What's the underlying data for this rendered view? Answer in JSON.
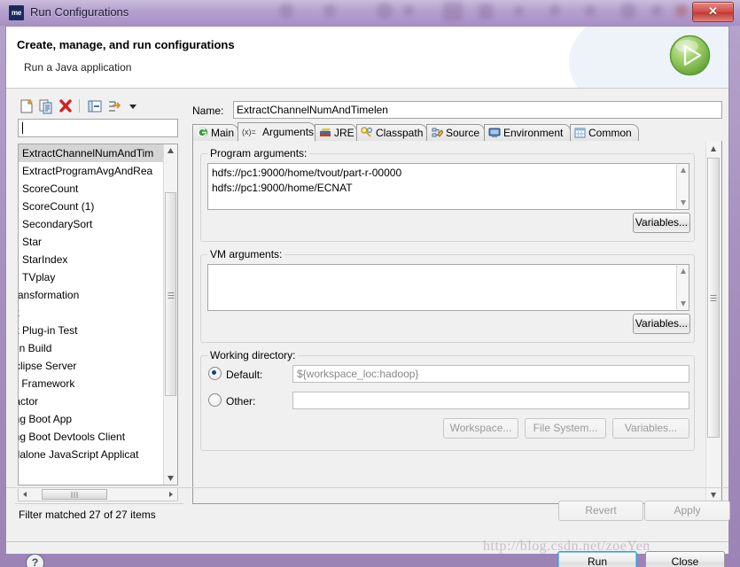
{
  "window": {
    "title": "Run Configurations",
    "app_icon": "me",
    "close_label": "✕"
  },
  "banner": {
    "title": "Create, manage, and run configurations",
    "subtitle": "Run a Java application",
    "icon": "run-green-play-icon"
  },
  "left_panel": {
    "toolbar": [
      {
        "name": "new-launch-configuration-icon",
        "title": "New launch configuration"
      },
      {
        "name": "duplicate-launch-configuration-icon",
        "title": "Duplicate"
      },
      {
        "name": "delete-launch-configuration-icon",
        "title": "Delete"
      },
      {
        "name": "collapse-all-icon",
        "title": "Collapse All"
      },
      {
        "name": "filter-launch-configurations-icon",
        "title": "Filter"
      },
      {
        "name": "view-menu-chevron-down-icon",
        "title": "View Menu"
      }
    ],
    "filter_value": "",
    "filter_placeholder": "type filter text",
    "items": [
      {
        "label": "ExtractChannelNumAndTim",
        "selected": true,
        "clipped": false
      },
      {
        "label": "ExtractProgramAvgAndRea",
        "selected": false,
        "clipped": false
      },
      {
        "label": "ScoreCount",
        "selected": false,
        "clipped": false
      },
      {
        "label": "ScoreCount (1)",
        "selected": false,
        "clipped": false
      },
      {
        "label": "SecondarySort",
        "selected": false,
        "clipped": false
      },
      {
        "label": "Star",
        "selected": false,
        "clipped": false
      },
      {
        "label": "StarIndex",
        "selected": false,
        "clipped": false
      },
      {
        "label": "TVplay",
        "selected": false,
        "clipped": false
      },
      {
        "label": "Transformation",
        "selected": false,
        "clipped": true
      },
      {
        "label": "nit",
        "selected": false,
        "clipped": true
      },
      {
        "label": "nit Plug-in Test",
        "selected": false,
        "clipped": true
      },
      {
        "label": "ven Build",
        "selected": false,
        "clipped": true
      },
      {
        "label": "Eclipse Server",
        "selected": false,
        "clipped": true
      },
      {
        "label": "Gi Framework",
        "selected": false,
        "clipped": true
      },
      {
        "label": "tractor",
        "selected": false,
        "clipped": true
      },
      {
        "label": "ring Boot App",
        "selected": false,
        "clipped": true
      },
      {
        "label": "ring Boot Devtools Client",
        "selected": false,
        "clipped": true
      },
      {
        "label": "ndalone JavaScript Applicat",
        "selected": false,
        "clipped": true
      }
    ],
    "status": "Filter matched 27 of 27 items"
  },
  "right_panel": {
    "name_label": "Name:",
    "name_value": "ExtractChannelNumAndTimelen",
    "tabs": [
      {
        "label": "Main",
        "icon": "main-tab-icon",
        "active": false
      },
      {
        "label": "Arguments",
        "icon": "arguments-tab-icon",
        "active": true
      },
      {
        "label": "JRE",
        "icon": "jre-tab-icon",
        "active": false
      },
      {
        "label": "Classpath",
        "icon": "classpath-tab-icon",
        "active": false
      },
      {
        "label": "Source",
        "icon": "source-tab-icon",
        "active": false
      },
      {
        "label": "Environment",
        "icon": "environment-tab-icon",
        "active": false
      },
      {
        "label": "Common",
        "icon": "common-tab-icon",
        "active": false
      }
    ],
    "program_arguments": {
      "label": "Program arguments:",
      "value": "hdfs://pc1:9000/home/tvout/part-r-00000\nhdfs://pc1:9000/home/ECNAT",
      "variables_button": "Variables..."
    },
    "vm_arguments": {
      "label": "VM arguments:",
      "value": "",
      "variables_button": "Variables..."
    },
    "working_directory": {
      "label": "Working directory:",
      "default_label": "Default:",
      "default_selected": true,
      "default_value": "${workspace_loc:hadoop}",
      "other_label": "Other:",
      "other_selected": false,
      "other_value": "",
      "buttons": [
        {
          "label": "Workspace...",
          "disabled": true
        },
        {
          "label": "File System...",
          "disabled": true
        },
        {
          "label": "Variables...",
          "disabled": true
        }
      ]
    },
    "revert_button": {
      "label": "Revert",
      "disabled": true
    },
    "apply_button": {
      "label": "Apply",
      "disabled": true
    }
  },
  "footer": {
    "help_icon": "?",
    "run_button": "Run",
    "close_button": "Close",
    "watermark": "http://blog.csdn.net/zoeYen_"
  },
  "colors": {
    "window_chrome": "#a791bf",
    "dialog_bg": "#f0f0f0",
    "accent_focus": "#3c9ad6",
    "close_red": "#c03a33",
    "run_green": "#7cc14b",
    "selection_gray": "#d5d5d5"
  }
}
